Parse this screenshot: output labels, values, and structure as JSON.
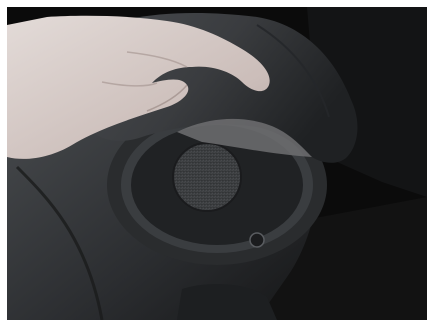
{
  "photo": {
    "subject": "hand-lifting-seat-cover",
    "colors": {
      "background": "#0b0b0b",
      "seat_leather": "#3f4245",
      "seat_shadow": "#1d1f21",
      "speaker_grille": "#4a4d50",
      "speaker_ring": "#2a2c2e",
      "cover_flap": "#3b3d40",
      "cover_inner": "#707072",
      "skin": "#d7cfcc",
      "skin_shadow": "#b9aaa6",
      "carpet": "#121212"
    }
  }
}
